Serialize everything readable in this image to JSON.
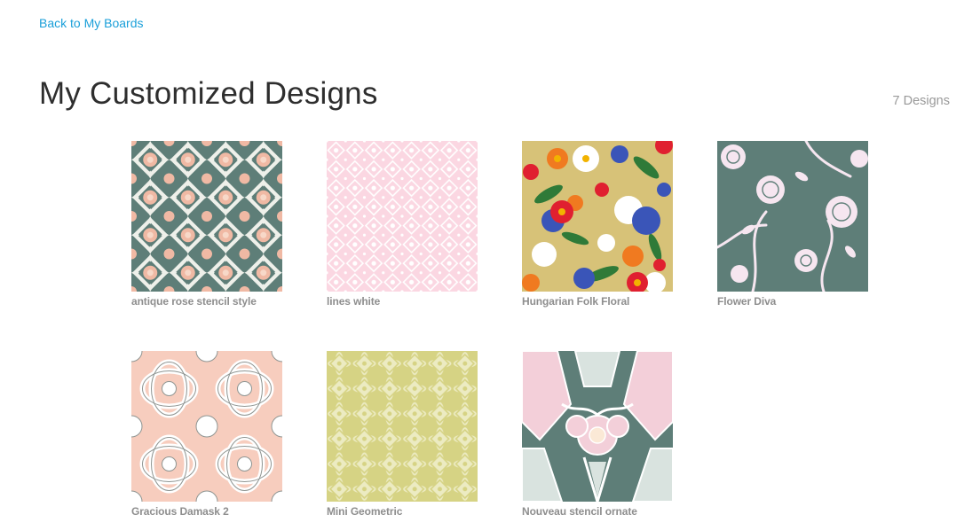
{
  "nav": {
    "back_label": "Back to My Boards"
  },
  "header": {
    "title": "My Customized Designs",
    "count": "7 Designs"
  },
  "designs": [
    {
      "name": "antique rose stencil style"
    },
    {
      "name": "lines white"
    },
    {
      "name": "Hungarian Folk Floral"
    },
    {
      "name": "Flower Diva"
    },
    {
      "name": "Gracious Damask 2"
    },
    {
      "name": "Mini Geometric"
    },
    {
      "name": "Nouveau stencil ornate"
    }
  ],
  "colors": {
    "link": "#1a9fd9",
    "title": "#2e2e2e",
    "caption": "#8e8e8e",
    "sage": "#5e7e78",
    "blush": "#fbd7e2",
    "peach": "#f7cdbe",
    "chartreuse": "#d6d384",
    "mustard": "#d7c278"
  }
}
